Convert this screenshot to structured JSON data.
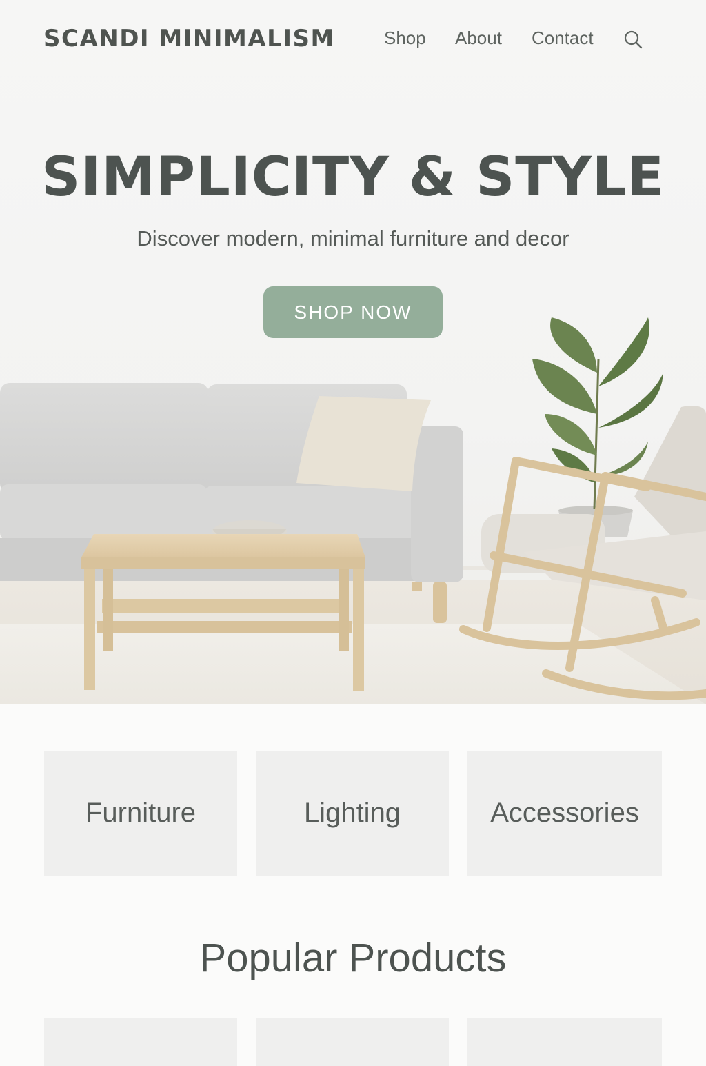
{
  "header": {
    "logo": "SCANDI MINIMALISM",
    "nav": [
      {
        "label": "Shop"
      },
      {
        "label": "About"
      },
      {
        "label": "Contact"
      }
    ],
    "search_icon": "search-icon"
  },
  "hero": {
    "title": "SIMPLICITY & STYLE",
    "subtitle": "Discover modern, minimal furniture and decor",
    "cta_label": "SHOP NOW",
    "cta_color": "#94ae9a"
  },
  "categories": [
    {
      "label": "Furniture"
    },
    {
      "label": "Lighting"
    },
    {
      "label": "Accessories"
    }
  ],
  "popular": {
    "title": "Popular Products"
  }
}
